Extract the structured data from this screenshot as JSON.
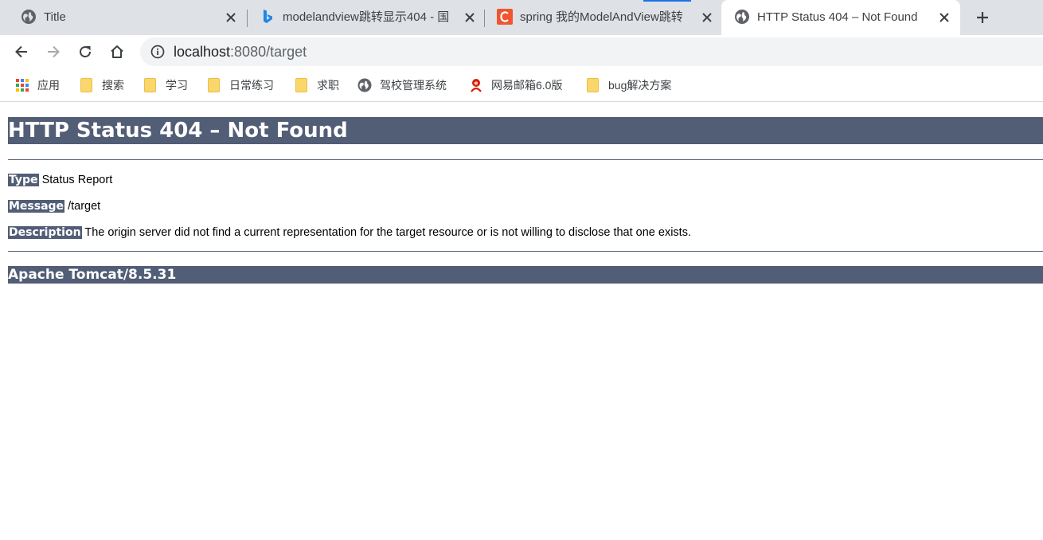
{
  "browser": {
    "tabs": [
      {
        "title": "Title",
        "favicon": "globe-icon"
      },
      {
        "title": "modelandview跳转显示404 - 国",
        "favicon": "bing-icon"
      },
      {
        "title": "spring 我的ModelAndView跳转",
        "favicon": "csdn-icon"
      },
      {
        "title": "HTTP Status 404 – Not Found",
        "favicon": "globe-icon"
      }
    ],
    "address_host": "localhost",
    "address_rest": ":8080/target",
    "bookmarks": [
      {
        "label": "应用",
        "icon": "apps-grid-icon"
      },
      {
        "label": "搜索",
        "icon": "folder-icon"
      },
      {
        "label": "学习",
        "icon": "folder-icon"
      },
      {
        "label": "日常练习",
        "icon": "folder-icon"
      },
      {
        "label": "求职",
        "icon": "folder-icon"
      },
      {
        "label": "驾校管理系统",
        "icon": "globe-icon"
      },
      {
        "label": "网易邮箱6.0版",
        "icon": "netease-mail-icon"
      },
      {
        "label": "bug解决方案",
        "icon": "folder-icon"
      }
    ],
    "accent_color": "#1a73e8"
  },
  "page": {
    "heading": "HTTP Status 404 – Not Found",
    "rows": [
      {
        "label": "Type",
        "value": "Status Report"
      },
      {
        "label": "Message",
        "value": "/target"
      },
      {
        "label": "Description",
        "value": "The origin server did not find a current representation for the target resource or is not willing to disclose that one exists."
      }
    ],
    "footer": "Apache Tomcat/8.5.31",
    "header_color": "#525d76"
  }
}
